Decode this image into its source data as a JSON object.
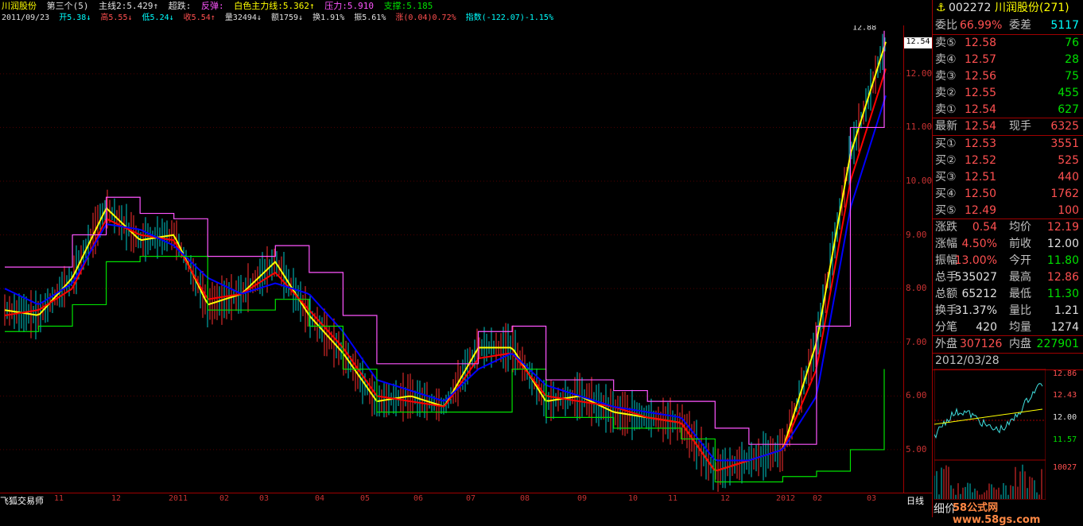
{
  "header": {
    "stock_name": "川润股份",
    "indicator_name": "第三个(5)",
    "line1_label": "主线2:5.429↑",
    "line2_label": "超跌:",
    "line3_label": "反弹:",
    "line4_label": "白色主力线:5.362↑",
    "line5_label": "压力:5.910",
    "line6_label": "支撑:5.185",
    "date": "2011/09/23",
    "open": "开5.38↓",
    "high": "高5.55↓",
    "low": "低5.24↓",
    "close": "收5.54↑",
    "volume": "量32494↓",
    "amount": "额1759↓",
    "turnover": "换1.91%",
    "amplitude": "振5.61%",
    "change": "涨(0.04)0.72%",
    "index": "指数(-122.07)-1.15%"
  },
  "chart_data": {
    "type": "line",
    "title": "川润股份",
    "x": [
      "11",
      "12",
      "2011",
      "02",
      "03",
      "04",
      "05",
      "06",
      "07",
      "08",
      "09",
      "10",
      "11",
      "12",
      "2012",
      "02",
      "03"
    ],
    "ylabels": [
      "12.00",
      "11.00",
      "10.00",
      "9.00",
      "8.00",
      "7.00",
      "6.00",
      "5.00"
    ],
    "ylim": [
      4.2,
      12.9
    ],
    "price_marks": {
      "high": "12.88",
      "low": "4.12",
      "current": "12.54"
    },
    "series": [
      {
        "color": "#ffff00",
        "values": [
          7.6,
          7.5,
          8.2,
          9.5,
          8.9,
          9.0,
          7.7,
          7.9,
          8.5,
          7.5,
          6.8,
          5.9,
          6.0,
          5.8,
          6.9,
          6.9,
          5.9,
          6.0,
          5.7,
          5.6,
          5.5,
          4.6,
          4.8,
          5.0,
          7.0,
          10.5,
          12.5
        ]
      },
      {
        "color": "#ff0000",
        "values": [
          7.5,
          7.6,
          8.0,
          9.3,
          9.0,
          8.9,
          7.8,
          7.9,
          8.3,
          7.6,
          6.9,
          6.0,
          5.9,
          5.8,
          6.7,
          6.8,
          6.0,
          5.9,
          5.8,
          5.6,
          5.5,
          4.6,
          4.8,
          5.0,
          6.5,
          10.0,
          12.0
        ]
      },
      {
        "color": "#0000ff",
        "values": [
          8.0,
          7.7,
          8.1,
          9.2,
          9.1,
          8.8,
          8.2,
          7.9,
          8.1,
          7.9,
          7.2,
          6.3,
          6.1,
          5.9,
          6.5,
          6.8,
          6.2,
          6.0,
          5.8,
          5.7,
          5.6,
          4.8,
          4.8,
          5.0,
          6.0,
          9.5,
          11.5
        ]
      },
      {
        "color": "#00e000",
        "values": [
          7.2,
          7.3,
          7.7,
          8.5,
          8.6,
          8.6,
          7.6,
          7.6,
          7.8,
          7.3,
          6.5,
          5.7,
          5.7,
          5.7,
          5.7,
          6.5,
          5.6,
          5.6,
          5.4,
          5.4,
          5.2,
          4.4,
          4.4,
          4.5,
          4.6,
          5.0,
          6.5
        ]
      },
      {
        "color": "#ff55ff",
        "values": [
          8.4,
          8.4,
          9.0,
          9.7,
          9.4,
          9.3,
          8.6,
          8.6,
          8.8,
          8.3,
          7.5,
          6.6,
          6.6,
          6.6,
          7.2,
          7.3,
          6.3,
          6.3,
          6.1,
          5.9,
          5.9,
          5.4,
          5.1,
          5.1,
          7.3,
          11.0,
          12.8
        ]
      }
    ]
  },
  "footer": {
    "label": "飞狐交易师",
    "period": "日线"
  },
  "panel": {
    "code": "002272",
    "name": "川润股份(271)",
    "webi_label": "委比",
    "webi_value": "66.99%",
    "weicha_label": "委差",
    "weicha_value": "5117",
    "sell": [
      {
        "label": "卖⑤",
        "price": "12.58",
        "qty": "76"
      },
      {
        "label": "卖④",
        "price": "12.57",
        "qty": "28"
      },
      {
        "label": "卖③",
        "price": "12.56",
        "qty": "75"
      },
      {
        "label": "卖②",
        "price": "12.55",
        "qty": "455"
      },
      {
        "label": "卖①",
        "price": "12.54",
        "qty": "627"
      }
    ],
    "latest_label": "最新",
    "latest_price": "12.54",
    "hand_label": "现手",
    "hand_qty": "6325",
    "buy": [
      {
        "label": "买①",
        "price": "12.53",
        "qty": "3551"
      },
      {
        "label": "买②",
        "price": "12.52",
        "qty": "525"
      },
      {
        "label": "买③",
        "price": "12.51",
        "qty": "440"
      },
      {
        "label": "买④",
        "price": "12.50",
        "qty": "1762"
      },
      {
        "label": "买⑤",
        "price": "12.49",
        "qty": "100"
      }
    ],
    "stats": [
      {
        "k1": "涨跌",
        "v1": "0.54",
        "k2": "均价",
        "v2": "12.19"
      },
      {
        "k1": "涨幅",
        "v1": "4.50%",
        "k2": "前收",
        "v2": "12.00"
      },
      {
        "k1": "振幅",
        "v1": "13.00%",
        "k2": "今开",
        "v2": "11.80"
      },
      {
        "k1": "总手",
        "v1": "535027",
        "k2": "最高",
        "v2": "12.86"
      },
      {
        "k1": "总额",
        "v1": "65212",
        "k2": "最低",
        "v2": "11.30"
      },
      {
        "k1": "换手",
        "v1": "31.37%",
        "k2": "量比",
        "v2": "1.21"
      },
      {
        "k1": "分笔",
        "v1": "420",
        "k2": "均量",
        "v2": "1274"
      }
    ],
    "outer_label": "外盘",
    "outer_value": "307126",
    "inner_label": "内盘",
    "inner_value": "227901",
    "date": "2012/03/28",
    "mini_labels": [
      "12.86",
      "12.43",
      "12.00",
      "11.57",
      "10027"
    ],
    "detail_label": "细价",
    "watermark": "58公式网 www.58gs.com"
  }
}
